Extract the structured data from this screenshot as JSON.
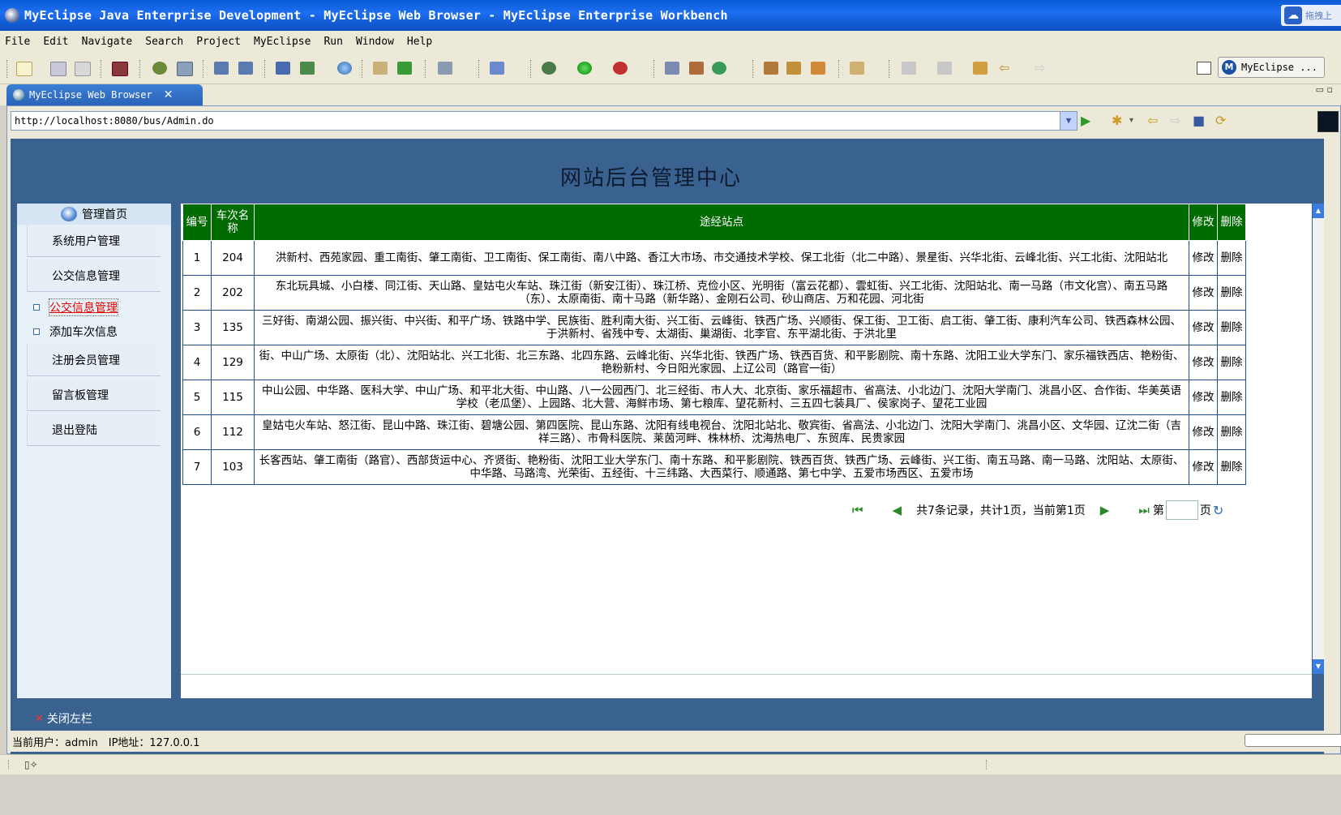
{
  "window": {
    "title": "MyEclipse Java Enterprise Development - MyEclipse Web Browser - MyEclipse Enterprise Workbench",
    "corner_text": "拖拽上"
  },
  "menu": [
    "File",
    "Edit",
    "Navigate",
    "Search",
    "Project",
    "MyEclipse",
    "Run",
    "Window",
    "Help"
  ],
  "perspective": {
    "label": "MyEclipse ..."
  },
  "tab": {
    "label": "MyEclipse Web Browser",
    "close": "✕"
  },
  "browser": {
    "url": "http://localhost:8080/bus/Admin.do"
  },
  "page": {
    "title": "网站后台管理中心",
    "sidebar": {
      "home": "管理首页",
      "items": [
        {
          "label": "系统用户管理",
          "type": "button"
        },
        {
          "label": "公交信息管理",
          "type": "button"
        },
        {
          "label": "公交信息管理",
          "type": "sub",
          "active": true
        },
        {
          "label": "添加车次信息",
          "type": "sub",
          "active": false
        },
        {
          "label": "注册会员管理",
          "type": "button"
        },
        {
          "label": "留言板管理",
          "type": "button"
        },
        {
          "label": "退出登陆",
          "type": "button"
        }
      ]
    },
    "table": {
      "headers": {
        "id": "编号",
        "name": "车次名称",
        "stops": "途经站点",
        "edit": "修改",
        "delete": "删除"
      },
      "edit_label": "修改",
      "delete_label": "删除",
      "rows": [
        {
          "id": "1",
          "name": "204",
          "stops": "洪新村、西苑家园、重工南街、肇工南街、卫工南街、保工南街、南八中路、香江大市场、市交通技术学校、保工北街（北二中路）、景星街、兴华北街、云峰北街、兴工北街、沈阳站北"
        },
        {
          "id": "2",
          "name": "202",
          "stops": "东北玩具城、小白楼、同江街、天山路、皇姑屯火车站、珠江街（新安江街）、珠江桥、克俭小区、光明街（富云花都）、雲虹街、兴工北街、沈阳站北、南一马路（市文化宫）、南五马路（东）、太原南街、南十马路（新华路）、金刚石公司、砂山商店、万和花园、河北街"
        },
        {
          "id": "3",
          "name": "135",
          "stops": "三好街、南湖公园、振兴街、中兴街、和平广场、铁路中学、民族街、胜利南大街、兴工街、云峰街、铁西广场、兴顺街、保工街、卫工街、启工街、肇工街、康利汽车公司、铁西森林公园、于洪新村、省残中专、太湖街、巢湖街、北李官、东平湖北街、于洪北里"
        },
        {
          "id": "4",
          "name": "129",
          "stops": "街、中山广场、太原街（北）、沈阳站北、兴工北街、北三东路、北四东路、云峰北街、兴华北街、铁西广场、铁西百货、和平影剧院、南十东路、沈阳工业大学东门、家乐福铁西店、艳粉街、艳粉新村、今日阳光家园、上辽公司（路官一街）"
        },
        {
          "id": "5",
          "name": "115",
          "stops": "中山公园、中华路、医科大学、中山广场、和平北大街、中山路、八一公园西门、北三经街、市人大、北京街、家乐福超市、省高法、小北边门、沈阳大学南门、洮昌小区、合作街、华美英语学校（老瓜堡）、上园路、北大营、海鲜市场、第七粮库、望花新村、三五四七装具厂、侯家岗子、望花工业园"
        },
        {
          "id": "6",
          "name": "112",
          "stops": "皇姑屯火车站、怒江街、昆山中路、珠江街、碧塘公园、第四医院、昆山东路、沈阳有线电视台、沈阳北站北、敬宾街、省高法、小北边门、沈阳大学南门、洮昌小区、文华园、辽沈二街（吉祥三路）、市骨科医院、莱茵河畔、株林桥、沈海热电厂、东贸库、民贵家园"
        },
        {
          "id": "7",
          "name": "103",
          "stops": "长客西站、肇工南街（路官）、西部货运中心、齐贤街、艳粉街、沈阳工业大学东门、南十东路、和平影剧院、铁西百货、铁西广场、云峰街、兴工街、南五马路、南一马路、沈阳站、太原街、中华路、马路湾、光荣街、五经街、十三纬路、大西菜行、顺通路、第七中学、五爱市场西区、五爱市场"
        }
      ]
    },
    "pager": {
      "summary": "共7条记录，共计1页，当前第1页",
      "page_prefix": "第",
      "page_suffix": "页",
      "page_value": ""
    },
    "close_sidebar": "关闭左栏",
    "user_info": "当前用户：admin　IP地址：127.0.0.1"
  }
}
